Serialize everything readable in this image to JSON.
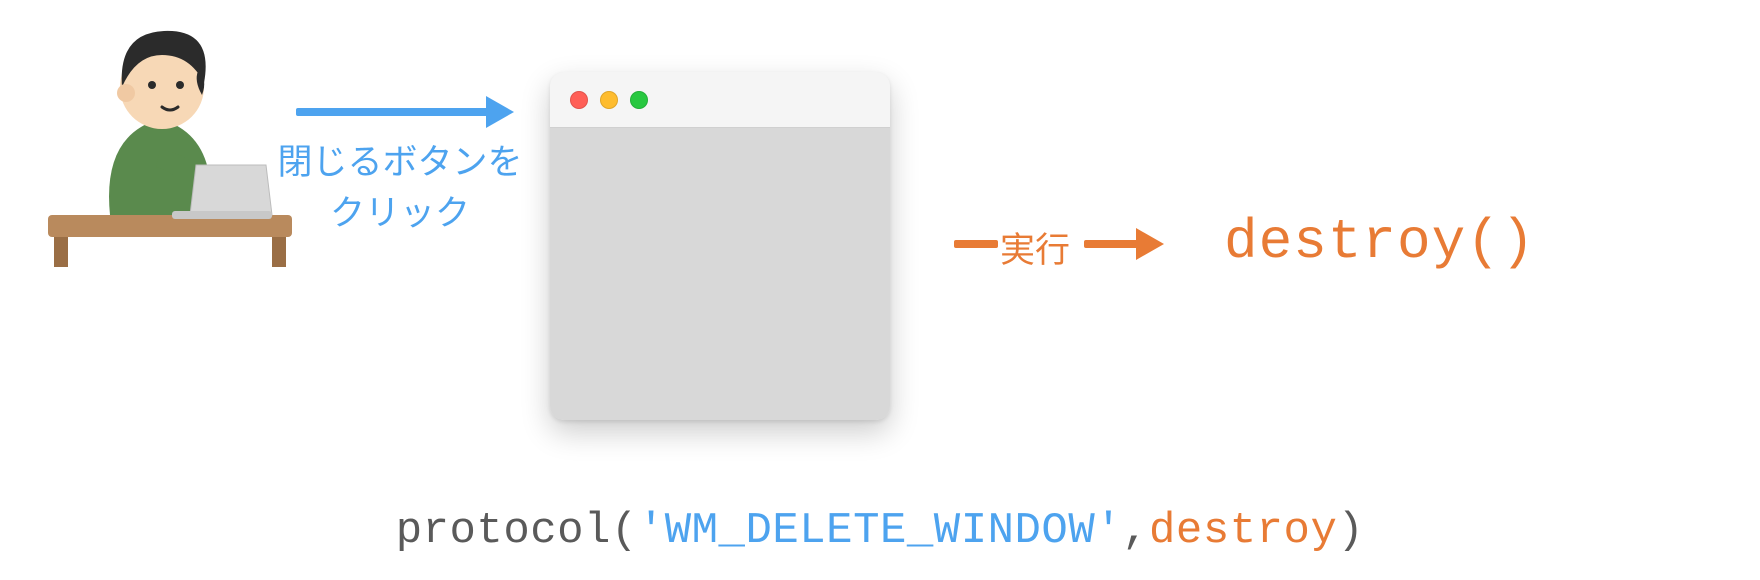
{
  "click_label_line1": "閉じるボタンを",
  "click_label_line2": "クリック",
  "execute_label": "実行",
  "destroy_call": "destroy()",
  "code": {
    "fn": "protocol",
    "open": "(",
    "arg1": "'WM_DELETE_WINDOW'",
    "comma": ",",
    "arg2": "destroy",
    "close": ")"
  }
}
